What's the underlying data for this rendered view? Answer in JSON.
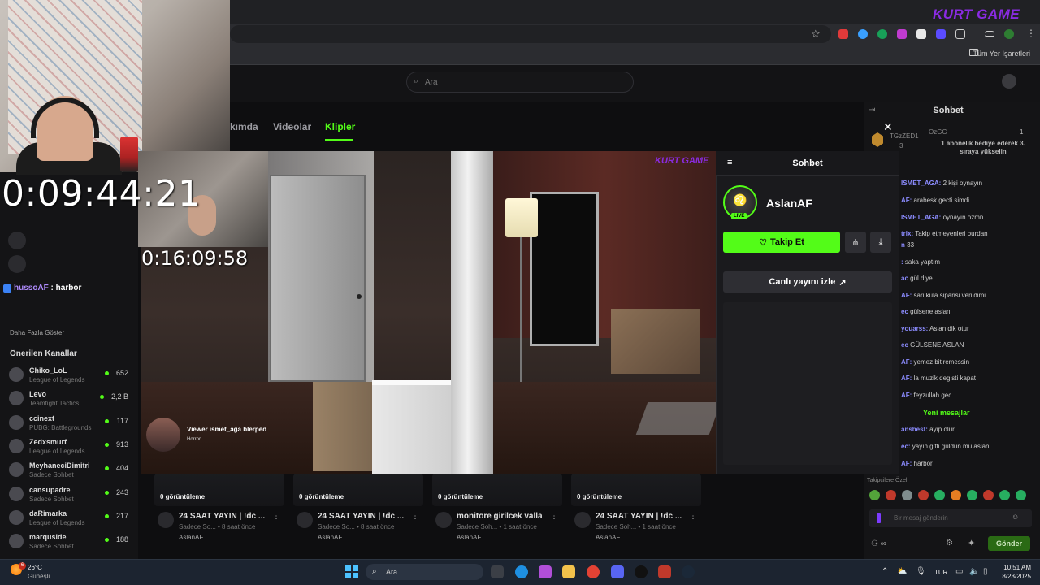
{
  "browser": {
    "bookmarks_all": "Tüm Yer İşaretleri",
    "logo_text": "KURT GAME"
  },
  "site": {
    "search_placeholder": "Ara",
    "tabs": [
      "kımda",
      "Videolar",
      "Klipler"
    ]
  },
  "stream_overlay": {
    "timer_main": "0:09:44:21",
    "timer_secondary": "0:16:09:58",
    "chat_user": "hussoAF",
    "chat_text": " : harbor",
    "video_logo": "KURT GAME",
    "alert_title": "Viewer ismet_aga blerped",
    "alert_sub": "Horror"
  },
  "sidebar": {
    "more_label": "Daha Fazla Göster",
    "recommended_label": "Önerilen Kanallar",
    "channels": [
      {
        "name": "Chiko_LoL",
        "game": "League of Legends",
        "viewers": "652"
      },
      {
        "name": "Levo",
        "game": "Teamfight Tactics",
        "viewers": "2,2 B"
      },
      {
        "name": "ccinext",
        "game": "PUBG: Battlegrounds",
        "viewers": "117"
      },
      {
        "name": "Zedxsmurf",
        "game": "League of Legends",
        "viewers": "913"
      },
      {
        "name": "MeyhaneciDimitri",
        "game": "Sadece Sohbet",
        "viewers": "404"
      },
      {
        "name": "cansupadre",
        "game": "Sadece Sohbet",
        "viewers": "243"
      },
      {
        "name": "daRimarka",
        "game": "League of Legends",
        "viewers": "217"
      },
      {
        "name": "marquside",
        "game": "Sadece Sohbet",
        "viewers": "188"
      }
    ]
  },
  "clips": [
    {
      "views": "0 görüntüleme",
      "title": "24 SAAT YAYIN | !dc ...",
      "sub": "Sadece So... • 8 saat önce",
      "channel": "AslanAF"
    },
    {
      "views": "0 görüntüleme",
      "title": "24 SAAT YAYIN | !dc ...",
      "sub": "Sadece So... • 8 saat önce",
      "channel": "AslanAF"
    },
    {
      "views": "0 görüntüleme",
      "title": "monitöre girilcek valla",
      "sub": "Sadece Soh... • 1 saat önce",
      "channel": "AslanAF"
    },
    {
      "views": "0 görüntüleme",
      "title": "24 SAAT YAYIN | !dc ...",
      "sub": "Sadece Soh... • 1 saat önce",
      "channel": "AslanAF"
    }
  ],
  "popout": {
    "title": "Sohbet",
    "streamer": "AslanAF",
    "live": "LIVE",
    "follow": "Takip Et",
    "watch": "Canlı yayını izle"
  },
  "chat": {
    "title": "Sohbet",
    "gift_user": "TGzZED1",
    "gift_user_count": "3",
    "gift_mod": "OzGG",
    "gift_text": "1 abonelik hediye ederek 3. sıraya yükselin",
    "gift_count": "1",
    "messages": [
      {
        "user": "ISMET_AGA:",
        "text": " 2 kişi oynayın"
      },
      {
        "user": "AF:",
        "text": " arabesk gecti simdi"
      },
      {
        "user": "ISMET_AGA:",
        "text": " oynayın ozmn"
      },
      {
        "user": "trix:",
        "text": " Takip etmeyenleri burdan"
      },
      {
        "user": "n",
        "text": " 33"
      },
      {
        "user": ":",
        "text": " saka yaptım"
      },
      {
        "user": "ac",
        "text": " gül diye"
      },
      {
        "user": "AF:",
        "text": " sari kula siparisi verildimi"
      },
      {
        "user": "ec",
        "text": " gülsene aslan"
      },
      {
        "user": "youarss:",
        "text": " Aslan dik otur"
      },
      {
        "user": "ec",
        "text": " GÜLSENE ASLAN"
      },
      {
        "user": "AF:",
        "text": " yemez bitiremessin"
      },
      {
        "user": "AF:",
        "text": " la muzik degisti kapat"
      },
      {
        "user": "AF:",
        "text": " feyzullah gec"
      },
      {
        "user": "ansbest:",
        "text": " ayıp olur"
      },
      {
        "user": "ec:",
        "text": " yayın gitti güldün mü aslan"
      },
      {
        "user": "AF:",
        "text": " harbor"
      }
    ],
    "new_messages": "Yeni mesajlar",
    "supporters": "Takipçilere Özel",
    "input_placeholder": "Bir mesaj gönderin",
    "send": "Gönder"
  },
  "taskbar": {
    "weather_temp": "26°C",
    "weather_desc": "Güneşli",
    "weather_alert": "6",
    "search": "Ara",
    "lang": "TUR",
    "time": "10:51 AM",
    "date": "8/23/2025"
  }
}
